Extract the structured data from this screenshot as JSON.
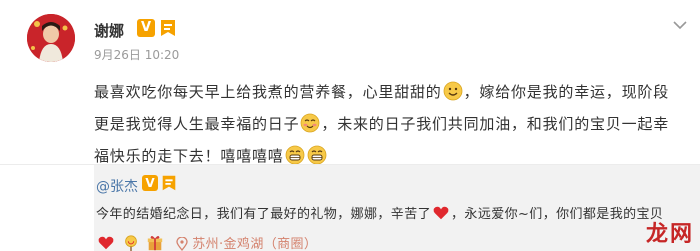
{
  "post": {
    "author": "谢娜",
    "verified_badge": "V",
    "time": "9月26日 10:20",
    "segments": {
      "s1": "最喜欢吃你每天早上给我煮的营养餐，心里甜甜的",
      "s2": "，嫁给你是我的幸运，现阶段更是我觉得人生最幸福的日子",
      "s3": "，未来的日子我们共同加油，和我们的宝贝一起幸福快乐的走下去！嘻嘻嘻嘻"
    },
    "emojis": [
      "smile-emoji",
      "blush-emoji",
      "grin-emoji",
      "grin-emoji"
    ]
  },
  "repost": {
    "author": "@张杰",
    "verified_badge": "V",
    "text_a": "今年的结婚纪念日，我们有了最好的礼物，娜娜，辛苦了",
    "text_b": "，永远爱你~们，你们都是我的宝贝",
    "location": "苏州·金鸡湖（商圈）",
    "emojis": [
      "red-heart-emoji",
      "red-heart-emoji",
      "lollipop-emoji",
      "gift-emoji"
    ]
  },
  "watermark": {
    "text": "龙网"
  },
  "colors": {
    "link": "#4a76a8",
    "badge": "#f6a200",
    "location": "#d4826d",
    "repost_bg": "#f2f2f2",
    "heart": "#e0282e"
  }
}
